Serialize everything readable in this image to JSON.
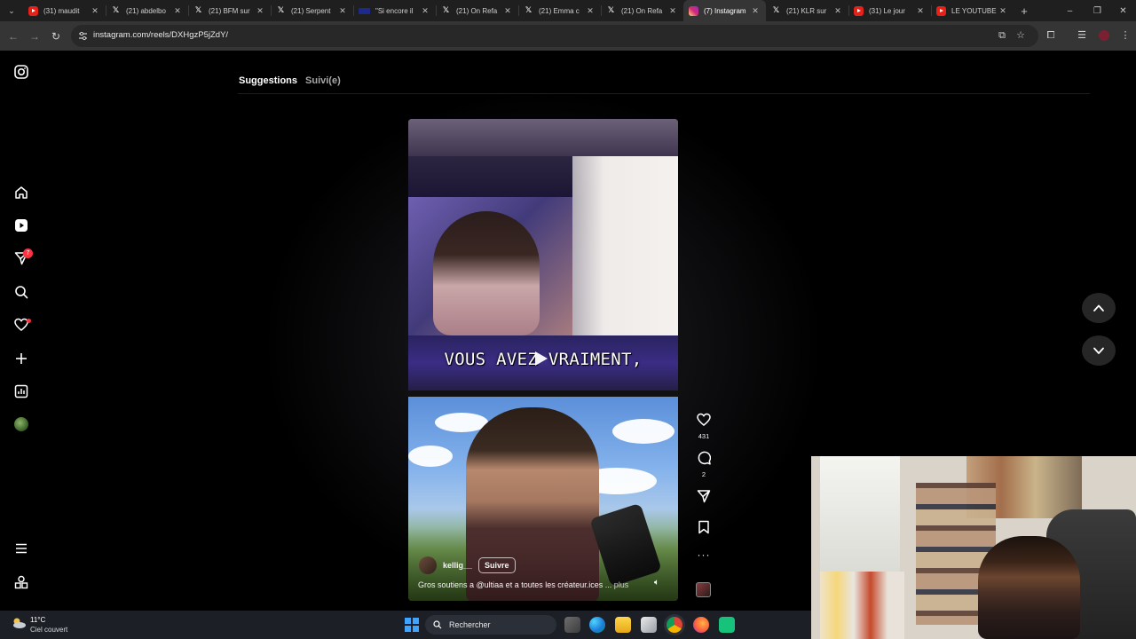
{
  "browser": {
    "tabs": [
      {
        "icon": "youtube-icon",
        "title": "(31) maudit",
        "active": false
      },
      {
        "icon": "x-icon",
        "title": "(21) abdelbo",
        "active": false
      },
      {
        "icon": "x-icon",
        "title": "(21) BFM sur",
        "active": false
      },
      {
        "icon": "x-icon",
        "title": "(21) Serpent",
        "active": false
      },
      {
        "icon": "news-icon",
        "title": "\"Si encore il",
        "active": false
      },
      {
        "icon": "x-icon",
        "title": "(21) On Refa",
        "active": false
      },
      {
        "icon": "x-icon",
        "title": "(21) Emma c",
        "active": false
      },
      {
        "icon": "x-icon",
        "title": "(21) On Refa",
        "active": false
      },
      {
        "icon": "instagram-icon",
        "title": "(7) Instagram",
        "active": true
      },
      {
        "icon": "x-icon",
        "title": "(21) KLR sur",
        "active": false
      },
      {
        "icon": "youtube-icon",
        "title": "(31) Le jour",
        "active": false
      },
      {
        "icon": "youtube-icon",
        "title": "LE YOUTUBE",
        "active": false
      }
    ],
    "url": "instagram.com/reels/DXHgzP5jZdY/"
  },
  "instagram": {
    "sidebar": {
      "notification_badge": "7"
    },
    "feed_tabs": {
      "suggestions": "Suggestions",
      "following": "Suivi(e)"
    },
    "reel": {
      "burned_caption": "VOUS AVEZ VRAIMENT,",
      "author": "kellig__",
      "follow_label": "Suivre",
      "caption": "Gros soutiens a @ultiaa et a toutes les créateur.ices ...",
      "more_label": "plus",
      "likes": "431",
      "comments": "2"
    }
  },
  "taskbar": {
    "weather_temp": "11°C",
    "weather_desc": "Ciel couvert",
    "search_placeholder": "Rechercher"
  },
  "colors": {
    "instagram_background": "#000000",
    "notification_red": "#ff3040",
    "chrome_tab_strip": "#1f1f1f",
    "chrome_toolbar": "#353535"
  }
}
